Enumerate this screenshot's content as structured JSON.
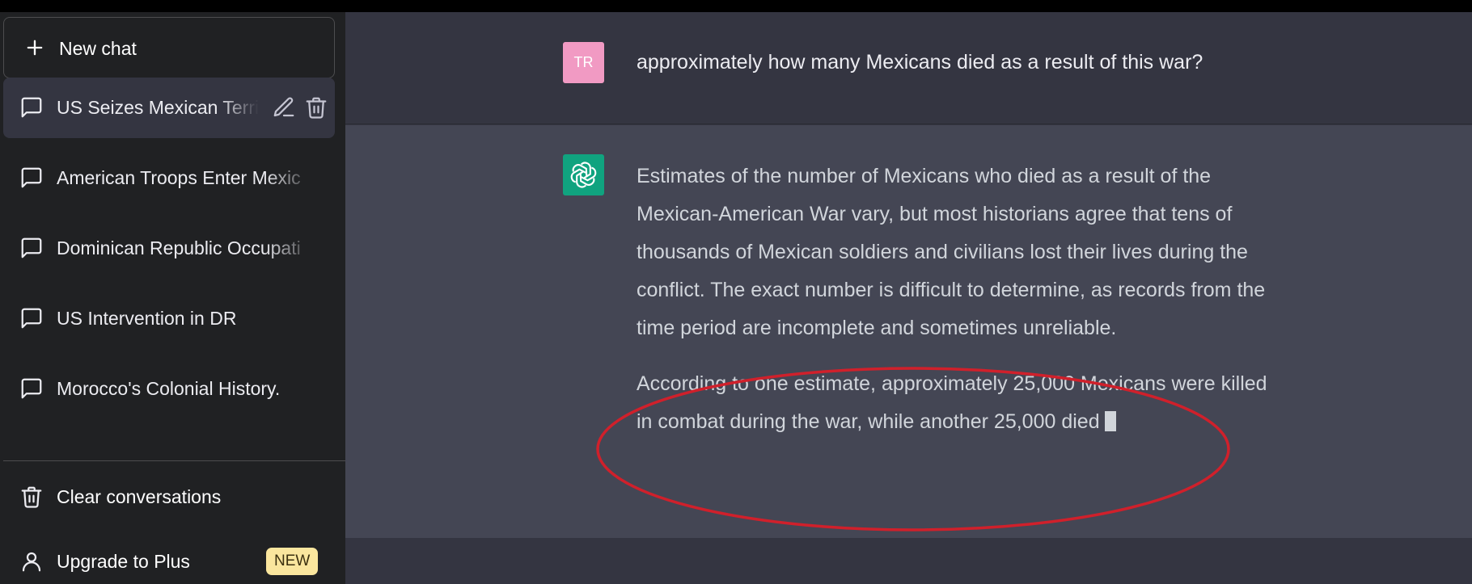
{
  "sidebar": {
    "new_chat_label": "New chat",
    "conversations": [
      {
        "title": "US Seizes Mexican Terri",
        "active": true
      },
      {
        "title": "American Troops Enter Mexic"
      },
      {
        "title": "Dominican Republic Occupati"
      },
      {
        "title": "US Intervention in DR"
      },
      {
        "title": "Morocco's Colonial History."
      }
    ],
    "clear_label": "Clear conversations",
    "upgrade_label": "Upgrade to Plus",
    "upgrade_badge": "NEW"
  },
  "thread": {
    "user_initials": "TR",
    "user_message": "approximately how many Mexicans died as a result of this war?",
    "assistant_paragraphs": [
      "Estimates of the number of Mexicans who died as a result of the Mexican-American War vary, but most historians agree that tens of thousands of Mexican soldiers and civilians lost their lives during the conflict. The exact number is difficult to determine, as records from the time period are incomplete and sometimes unreliable.",
      "According to one estimate, approximately 25,000 Mexicans were killed in combat during the war, while another 25,000 died"
    ]
  },
  "colors": {
    "sidebar_bg": "#202123",
    "main_bg": "#343541",
    "assistant_bg": "#444654",
    "user_avatar": "#f19ac3",
    "bot_avatar": "#10a37f",
    "annotation": "#d0202b",
    "badge": "#fae69e"
  },
  "icons": [
    "plus-icon",
    "chat-bubble-icon",
    "pencil-icon",
    "trash-icon",
    "user-icon",
    "openai-logo-icon"
  ]
}
